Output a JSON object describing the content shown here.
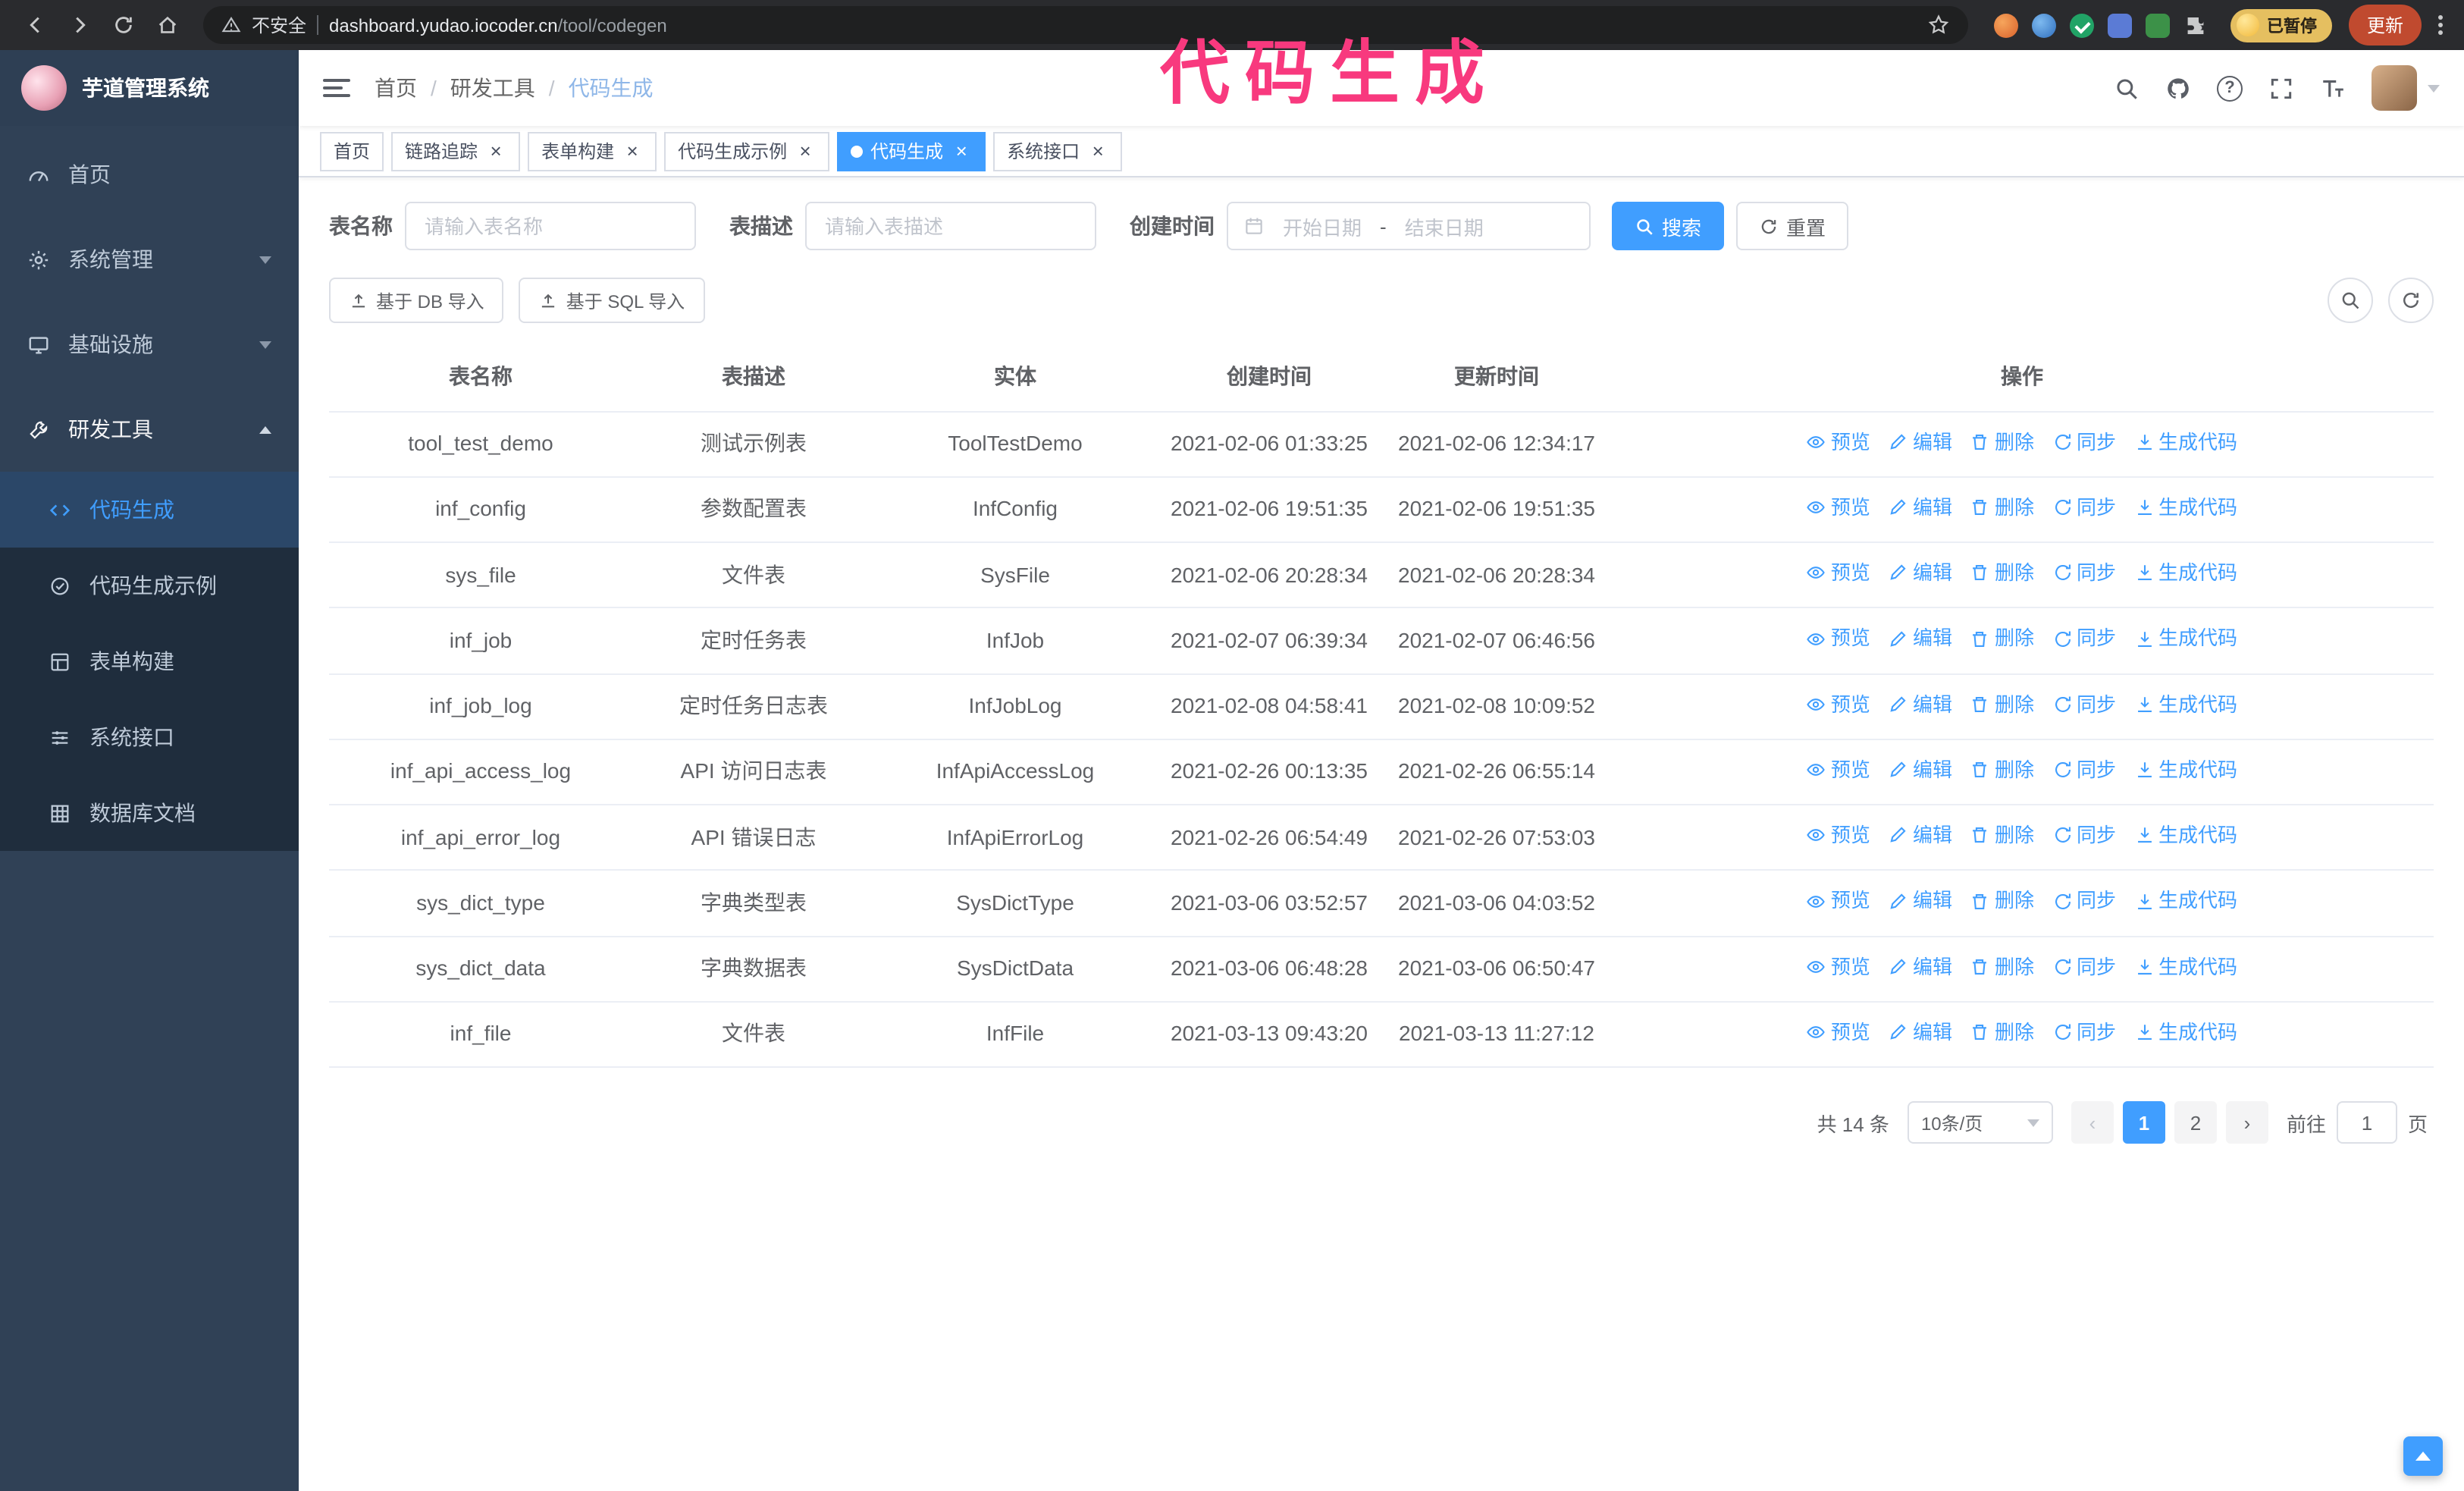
{
  "browser": {
    "security_label": "不安全",
    "url_host": "dashboard.yudao.iocoder.cn",
    "url_path": "/tool/codegen",
    "paused_badge": "已暂停",
    "update_button": "更新"
  },
  "annotation": {
    "text": "代码生成"
  },
  "sidebar": {
    "title": "芋道管理系统",
    "items": [
      {
        "label": "首页",
        "icon": "dashboard-icon",
        "expandable": false
      },
      {
        "label": "系统管理",
        "icon": "gear-icon",
        "expandable": true
      },
      {
        "label": "基础设施",
        "icon": "monitor-icon",
        "expandable": true
      },
      {
        "label": "研发工具",
        "icon": "wrench-icon",
        "expandable": true,
        "expanded": true
      }
    ],
    "sub_items": [
      {
        "label": "代码生成",
        "icon": "code-icon",
        "active": true
      },
      {
        "label": "代码生成示例",
        "icon": "badge-icon",
        "active": false
      },
      {
        "label": "表单构建",
        "icon": "form-icon",
        "active": false
      },
      {
        "label": "系统接口",
        "icon": "api-icon",
        "active": false
      },
      {
        "label": "数据库文档",
        "icon": "database-icon",
        "active": false
      }
    ]
  },
  "breadcrumb": {
    "items": [
      "首页",
      "研发工具",
      "代码生成"
    ],
    "separator": "/"
  },
  "tabs": [
    {
      "label": "首页",
      "closable": false,
      "active": false
    },
    {
      "label": "链路追踪",
      "closable": true,
      "active": false
    },
    {
      "label": "表单构建",
      "closable": true,
      "active": false
    },
    {
      "label": "代码生成示例",
      "closable": true,
      "active": false
    },
    {
      "label": "代码生成",
      "closable": true,
      "active": true
    },
    {
      "label": "系统接口",
      "closable": true,
      "active": false
    }
  ],
  "filters": {
    "table_name_label": "表名称",
    "table_name_placeholder": "请输入表名称",
    "table_desc_label": "表描述",
    "table_desc_placeholder": "请输入表描述",
    "create_time_label": "创建时间",
    "date_start_placeholder": "开始日期",
    "date_separator": "-",
    "date_end_placeholder": "结束日期",
    "search_button": "搜索",
    "reset_button": "重置"
  },
  "toolbar": {
    "import_db_button": "基于 DB 导入",
    "import_sql_button": "基于 SQL 导入"
  },
  "table": {
    "columns": [
      "表名称",
      "表描述",
      "实体",
      "创建时间",
      "更新时间",
      "操作"
    ],
    "actions": [
      "预览",
      "编辑",
      "删除",
      "同步",
      "生成代码"
    ],
    "action_keys": [
      "preview",
      "edit",
      "delete",
      "sync",
      "generate"
    ],
    "rows": [
      {
        "name": "tool_test_demo",
        "desc": "测试示例表",
        "entity": "ToolTestDemo",
        "created": "2021-02-06 01:33:25",
        "updated": "2021-02-06 12:34:17"
      },
      {
        "name": "inf_config",
        "desc": "参数配置表",
        "entity": "InfConfig",
        "created": "2021-02-06 19:51:35",
        "updated": "2021-02-06 19:51:35"
      },
      {
        "name": "sys_file",
        "desc": "文件表",
        "entity": "SysFile",
        "created": "2021-02-06 20:28:34",
        "updated": "2021-02-06 20:28:34"
      },
      {
        "name": "inf_job",
        "desc": "定时任务表",
        "entity": "InfJob",
        "created": "2021-02-07 06:39:34",
        "updated": "2021-02-07 06:46:56"
      },
      {
        "name": "inf_job_log",
        "desc": "定时任务日志表",
        "entity": "InfJobLog",
        "created": "2021-02-08 04:58:41",
        "updated": "2021-02-08 10:09:52"
      },
      {
        "name": "inf_api_access_log",
        "desc": "API 访问日志表",
        "entity": "InfApiAccessLog",
        "created": "2021-02-26 00:13:35",
        "updated": "2021-02-26 06:55:14"
      },
      {
        "name": "inf_api_error_log",
        "desc": "API 错误日志",
        "entity": "InfApiErrorLog",
        "created": "2021-02-26 06:54:49",
        "updated": "2021-02-26 07:53:03"
      },
      {
        "name": "sys_dict_type",
        "desc": "字典类型表",
        "entity": "SysDictType",
        "created": "2021-03-06 03:52:57",
        "updated": "2021-03-06 04:03:52"
      },
      {
        "name": "sys_dict_data",
        "desc": "字典数据表",
        "entity": "SysDictData",
        "created": "2021-03-06 06:48:28",
        "updated": "2021-03-06 06:50:47"
      },
      {
        "name": "inf_file",
        "desc": "文件表",
        "entity": "InfFile",
        "created": "2021-03-13 09:43:20",
        "updated": "2021-03-13 11:27:12"
      }
    ]
  },
  "pagination": {
    "total": "共 14 条",
    "page_size": "10条/页",
    "pages": [
      "1",
      "2"
    ],
    "active_page": "1",
    "goto_label": "前往",
    "goto_value": "1",
    "goto_suffix": "页"
  },
  "glyphs": {
    "close": "×",
    "prev": "‹",
    "next": "›",
    "question": "?"
  },
  "colors": {
    "primary": "#409eff",
    "sidebar_bg": "#304156",
    "submenu_bg": "#1f2d3d",
    "tag_active_bg": "#409eff",
    "annotation_pink": "#f8397e",
    "update_button_bg": "#c04a2f",
    "paused_badge_bg": "#e5bf60"
  }
}
